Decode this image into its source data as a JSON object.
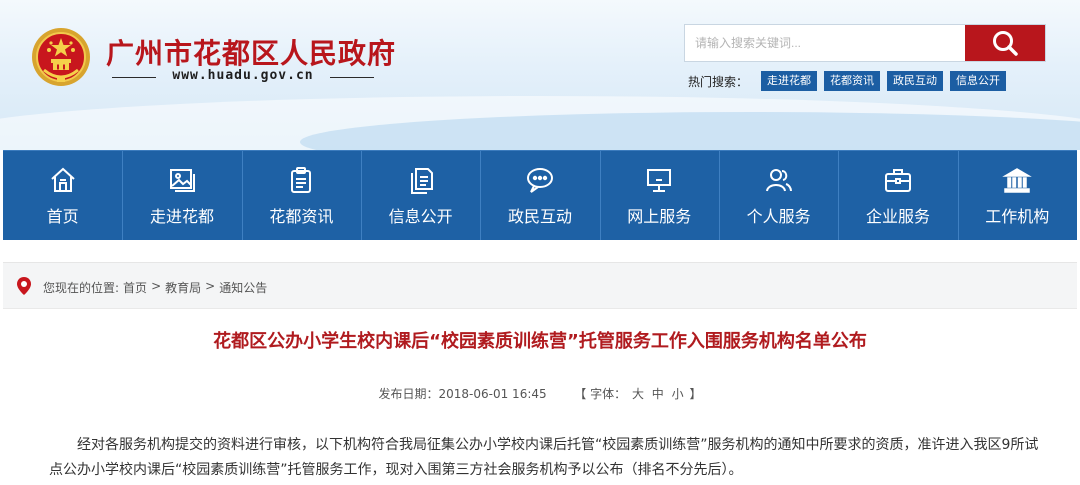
{
  "site": {
    "title": "广州市花都区人民政府",
    "url": "www.huadu.gov.cn"
  },
  "search": {
    "placeholder": "请输入搜索关键词..."
  },
  "hot_search": {
    "label": "热门搜索：",
    "tags": [
      "走进花都",
      "花都资讯",
      "政民互动",
      "信息公开"
    ]
  },
  "nav": [
    {
      "label": "首页",
      "icon": "home-icon"
    },
    {
      "label": "走进花都",
      "icon": "picture-icon"
    },
    {
      "label": "花都资讯",
      "icon": "clipboard-icon"
    },
    {
      "label": "信息公开",
      "icon": "document-icon"
    },
    {
      "label": "政民互动",
      "icon": "chat-icon"
    },
    {
      "label": "网上服务",
      "icon": "monitor-icon"
    },
    {
      "label": "个人服务",
      "icon": "people-icon"
    },
    {
      "label": "企业服务",
      "icon": "briefcase-icon"
    },
    {
      "label": "工作机构",
      "icon": "institution-icon"
    }
  ],
  "breadcrumb": {
    "prefix": "您现在的位置:",
    "items": [
      "首页",
      "教育局",
      "通知公告"
    ],
    "separator": ">"
  },
  "article": {
    "title": "花都区公办小学生校内课后“校园素质训练营”托管服务工作入围服务机构名单公布",
    "date_label": "发布日期：",
    "date": "2018-06-01 16:45",
    "font_open": "【 字体：",
    "font_sizes": [
      "大",
      "中",
      "小"
    ],
    "font_close": "】",
    "paragraph": "经对各服务机构提交的资料进行审核，以下机构符合我局征集公办小学校内课后托管“校园素质训练营”服务机构的通知中所要求的资质，准许进入我区9所试点公办小学校内课后“校园素质训练营”托管服务工作，现对入围第三方社会服务机构予以公布（排名不分先后）。"
  },
  "colors": {
    "brand_red": "#b8161c",
    "nav_blue": "#1e61a5",
    "tag_blue": "#1c5ea3",
    "title_red": "#b01b1f"
  }
}
